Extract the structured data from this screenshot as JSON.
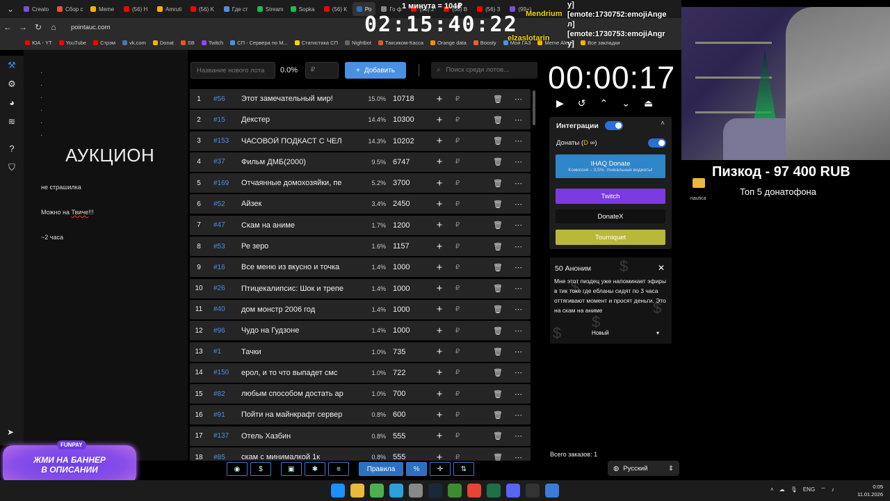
{
  "browser": {
    "tabs": [
      {
        "label": "Creato",
        "color": "#7b4fd6"
      },
      {
        "label": "Сбор с",
        "color": "#e8542a"
      },
      {
        "label": "Meme",
        "color": "#f5b400"
      },
      {
        "label": "(56) Н",
        "color": "#ff0000"
      },
      {
        "label": "Amruti",
        "color": "#f5b400"
      },
      {
        "label": "(56) K",
        "color": "#ff0000"
      },
      {
        "label": "Где ст",
        "color": "#4a90e2"
      },
      {
        "label": "Stream",
        "color": "#1db954"
      },
      {
        "label": "Sopka",
        "color": "#1db954"
      },
      {
        "label": "(56) К",
        "color": "#ff0000"
      },
      {
        "label": "Ро",
        "color": "#2d6fc0"
      },
      {
        "label": "Го ф",
        "color": "#888888"
      },
      {
        "label": "(56) 2",
        "color": "#ff0000"
      },
      {
        "label": "(56) В",
        "color": "#ff0000"
      },
      {
        "label": "(56) З",
        "color": "#ff0000"
      },
      {
        "label": "(99+)",
        "color": "#7b4fd6"
      }
    ],
    "url": "pointauc.com",
    "bookmarks": [
      {
        "label": "ЮА - YT",
        "color": "#ff0000"
      },
      {
        "label": "YouTube",
        "color": "#ff0000"
      },
      {
        "label": "Стрэм",
        "color": "#ff0000"
      },
      {
        "label": "vk.com",
        "color": "#4a76a8"
      },
      {
        "label": "Donat",
        "color": "#f5b400"
      },
      {
        "label": "SB",
        "color": "#e8542a"
      },
      {
        "label": "Twitch",
        "color": "#9146ff"
      },
      {
        "label": "СП - Сервера по М...",
        "color": "#4a90e2"
      },
      {
        "label": "Статистика СП",
        "color": "#f5d400"
      },
      {
        "label": "Nightbot",
        "color": "#666666"
      },
      {
        "label": "Таксиком-Касса",
        "color": "#e8542a"
      },
      {
        "label": "Orange data",
        "color": "#ff8c00"
      },
      {
        "label": "Boosty",
        "color": "#f15f2c"
      },
      {
        "label": "Мой ГАЗ",
        "color": "#4a90e2"
      },
      {
        "label": "Meme Alerts",
        "color": "#f5b400"
      },
      {
        "label": "Все закладки",
        "color": "#f5b400"
      }
    ]
  },
  "overlay": {
    "stream_clock": "02:15:40:22",
    "minute_price": "1 минута = 104₽",
    "chat_lines": [
      "[emote:1730752:emojiAnge",
      "л]",
      "[emote:1730753:emojiAngr",
      "y]"
    ],
    "chat_prefix": "у]",
    "user_1": "Mendrium",
    "user_2": "elzaslotarin",
    "top_donor": "Пизкод - 97 400 RUB",
    "top_subtitle": "Топ  5 донатофона",
    "files_label": "nautica"
  },
  "notes": {
    "title": "АУКЦИОН",
    "line_1": "не страшилка",
    "line_2_prefix": "Можно на ",
    "line_2_word": "Твиче",
    "line_2_suffix": "!!!",
    "line_3": "~2 часа"
  },
  "toolbar": {
    "lot_name_placeholder": "Название нового лота",
    "percent": "0.0%",
    "amount_placeholder": "₽",
    "add_label": "Добавить",
    "search_placeholder": "Поиск среди лотов..."
  },
  "lots": [
    {
      "n": "1",
      "id": "#56",
      "name": "Этот замечательный мир!",
      "pct": "15.0%",
      "amount": "10718"
    },
    {
      "n": "2",
      "id": "#15",
      "name": "Декстер",
      "pct": "14.4%",
      "amount": "10300"
    },
    {
      "n": "3",
      "id": "#153",
      "name": " ЧАСОВОЙ ПОДКАСТ С ЧЕЛ",
      "pct": "14.3%",
      "amount": "10202"
    },
    {
      "n": "4",
      "id": "#37",
      "name": "Фильм ДМБ(2000)",
      "pct": "9.5%",
      "amount": "6747"
    },
    {
      "n": "5",
      "id": "#169",
      "name": " Отчаянные домохозяйки, пе",
      "pct": "5.2%",
      "amount": "3700"
    },
    {
      "n": "6",
      "id": "#52",
      "name": "Айзек",
      "pct": "3.4%",
      "amount": "2450"
    },
    {
      "n": "7",
      "id": "#47",
      "name": "Скам на аниме",
      "pct": "1.7%",
      "amount": "1200"
    },
    {
      "n": "8",
      "id": "#53",
      "name": "Ре зеро",
      "pct": "1.6%",
      "amount": "1157"
    },
    {
      "n": "9",
      "id": "#16",
      "name": "Все меню из вкусно и точка",
      "pct": "1.4%",
      "amount": "1000"
    },
    {
      "n": "10",
      "id": "#26",
      "name": "Птицекалипсис: Шок и трепе",
      "pct": "1.4%",
      "amount": "1000"
    },
    {
      "n": "11",
      "id": "#40",
      "name": "дом монстр 2006 год",
      "pct": "1.4%",
      "amount": "1000"
    },
    {
      "n": "12",
      "id": "#96",
      "name": "Чудо на Гудзоне",
      "pct": "1.4%",
      "amount": "1000"
    },
    {
      "n": "13",
      "id": "#1",
      "name": "Тачки",
      "pct": "1.0%",
      "amount": "735"
    },
    {
      "n": "14",
      "id": "#150",
      "name": " ерол, и то что выпадет смс",
      "pct": "1.0%",
      "amount": "722"
    },
    {
      "n": "15",
      "id": "#82",
      "name": "любым способом достать ар",
      "pct": "1.0%",
      "amount": "700"
    },
    {
      "n": "16",
      "id": "#91",
      "name": "Пойти на майнкрафт сервер",
      "pct": "0.8%",
      "amount": "600"
    },
    {
      "n": "17",
      "id": "#137",
      "name": " Отель Хазбин",
      "pct": "0.8%",
      "amount": "555"
    },
    {
      "n": "18",
      "id": "#85",
      "name": "скам с минималкой 1к",
      "pct": "0.8%",
      "amount": "555"
    }
  ],
  "bottom": {
    "rules_label": "Правила",
    "percent_symbol": "%",
    "dollar_symbol": "$"
  },
  "timer": {
    "value": "00:00:17"
  },
  "integrations": {
    "title": "Интеграции",
    "donations_label": "Донаты (",
    "services": [
      {
        "name": "IHAQ Donate",
        "sub": "Комиссия – 3,5%. Уникальные виджеты!",
        "color": "#2f86c8"
      },
      {
        "name": "Twitch",
        "sub": "",
        "color": "#7b3ae0"
      },
      {
        "name": "DonateX",
        "sub": "",
        "color": "#111111"
      },
      {
        "name": "Tourniquet",
        "sub": "",
        "color": "#b8b83a"
      }
    ]
  },
  "donation": {
    "title": "50 Аноним",
    "message": "Мне этот пиздец уже напоминает эфиры в тик токе где ебланы сидят по 3 часа оттягивают момент и просят деньги. Это на скам на аниме",
    "status": "Новый"
  },
  "orders": {
    "label": "Всего заказов:",
    "count": "1"
  },
  "language": "Русский",
  "banner": {
    "badge": "FUNPAY",
    "text_1": "ЖМИ НА БАННЕР",
    "text_2": "В ОПИСАНИИ"
  },
  "taskbar": {
    "lang": "ENG",
    "time": "0:05",
    "date": "11.01.2026",
    "icons": [
      "#1e90ff",
      "#e8b93a",
      "#4caf50",
      "#2aa1da",
      "#888888",
      "#1b2838",
      "#3c8d2f",
      "#ea4335",
      "#1e7145",
      "#5865f2",
      "#333333",
      "#3a7bd5"
    ]
  }
}
